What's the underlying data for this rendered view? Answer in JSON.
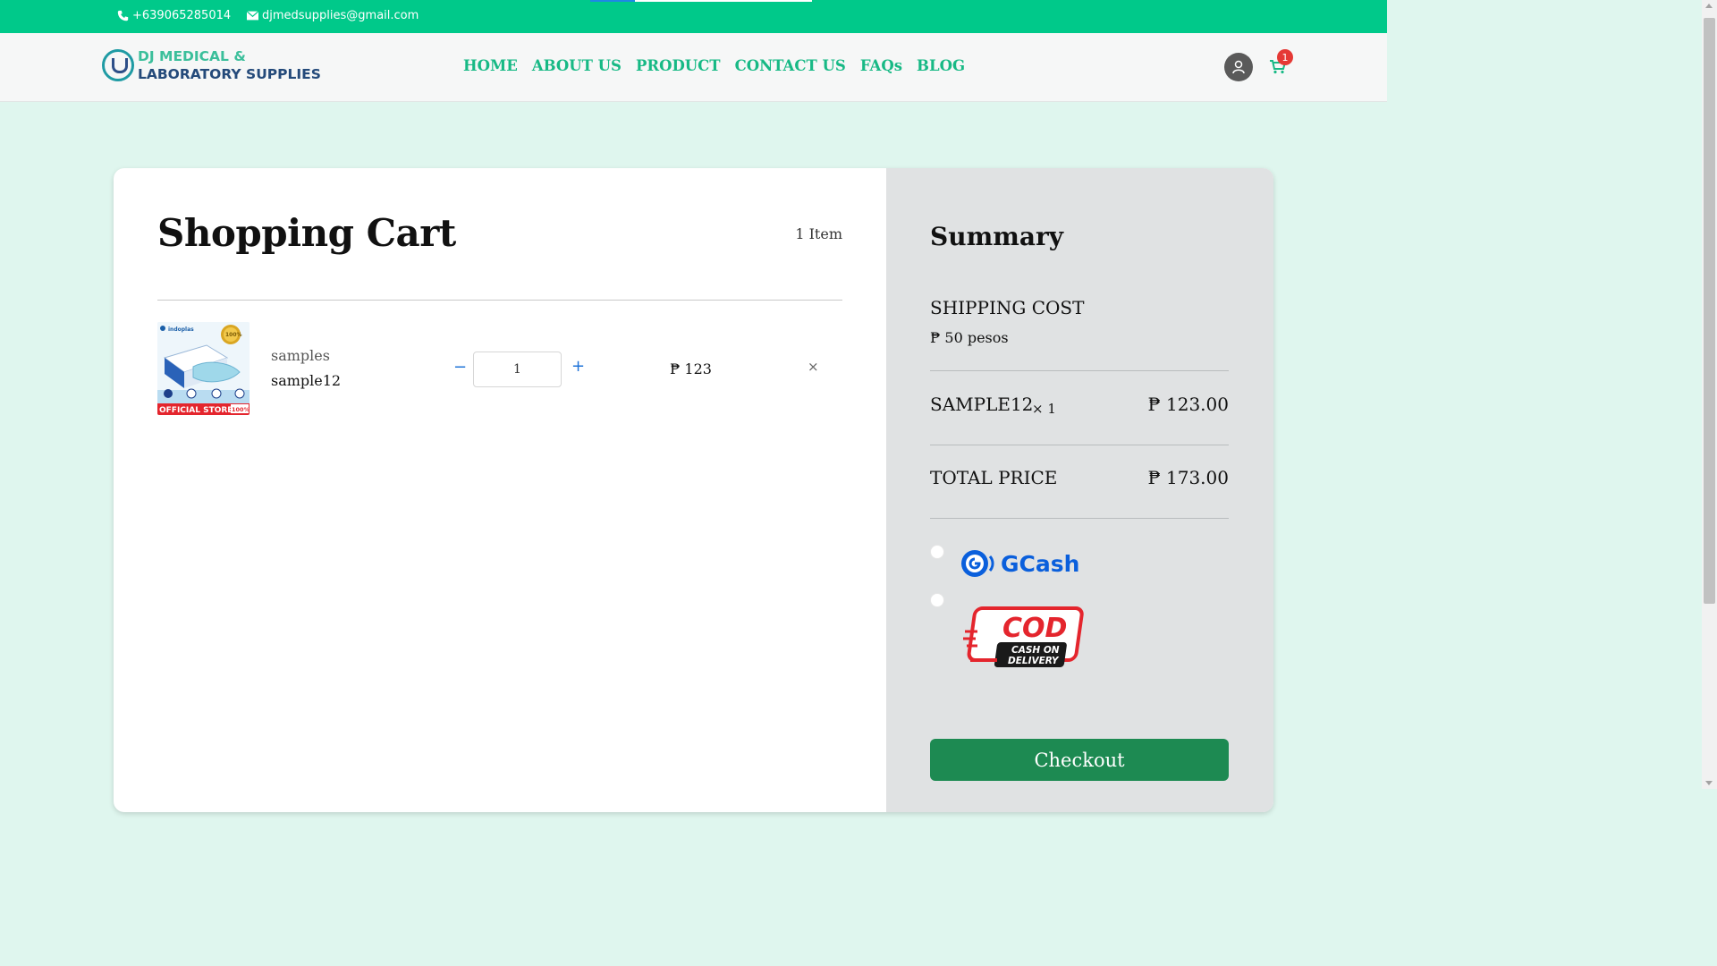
{
  "topbar": {
    "phone": "+639065285014",
    "email": "djmedsupplies@gmail.com"
  },
  "header": {
    "logo_line1": "DJ MEDICAL &",
    "logo_line2": "LABORATORY SUPPLIES",
    "nav": [
      "HOME",
      "ABOUT US",
      "PRODUCT",
      "CONTACT US",
      "FAQs",
      "BLOG"
    ],
    "cart_count": "1"
  },
  "cart": {
    "title": "Shopping Cart",
    "item_count": "1 Item",
    "items": [
      {
        "category": "samples",
        "name": "sample12",
        "quantity": "1",
        "price": "₱ 123",
        "image_text": {
          "brand": "indoplas",
          "badge": "100%",
          "banner": "OFFICIAL STORE",
          "banner_badge": "100%"
        }
      }
    ],
    "minus_symbol": "−",
    "plus_symbol": "+",
    "remove_symbol": "×"
  },
  "summary": {
    "title": "Summary",
    "shipping_label": "SHIPPING COST",
    "shipping_value": "₱ 50 pesos",
    "line_item_name": "SAMPLE12",
    "line_item_qty": "× 1",
    "line_item_price": "₱ 123.00",
    "total_label": "TOTAL PRICE",
    "total_value": "₱ 173.00",
    "payment_methods": {
      "gcash": "GCash",
      "cod_main": "COD",
      "cod_sub1": "CASH ON",
      "cod_sub2": "DELIVERY"
    },
    "checkout_label": "Checkout"
  },
  "colors": {
    "topbar": "#00c98a",
    "nav_text": "#17b985",
    "page_bg": "#dff6ee",
    "summary_bg": "#e0e2e3",
    "checkout": "#1d8a52",
    "gcash_blue": "#0a5fdc",
    "cod_red": "#e4252d",
    "badge_red": "#e53935"
  },
  "icons": [
    "phone-icon",
    "email-icon",
    "user-icon",
    "cart-icon",
    "minus-icon",
    "plus-icon",
    "close-icon"
  ]
}
